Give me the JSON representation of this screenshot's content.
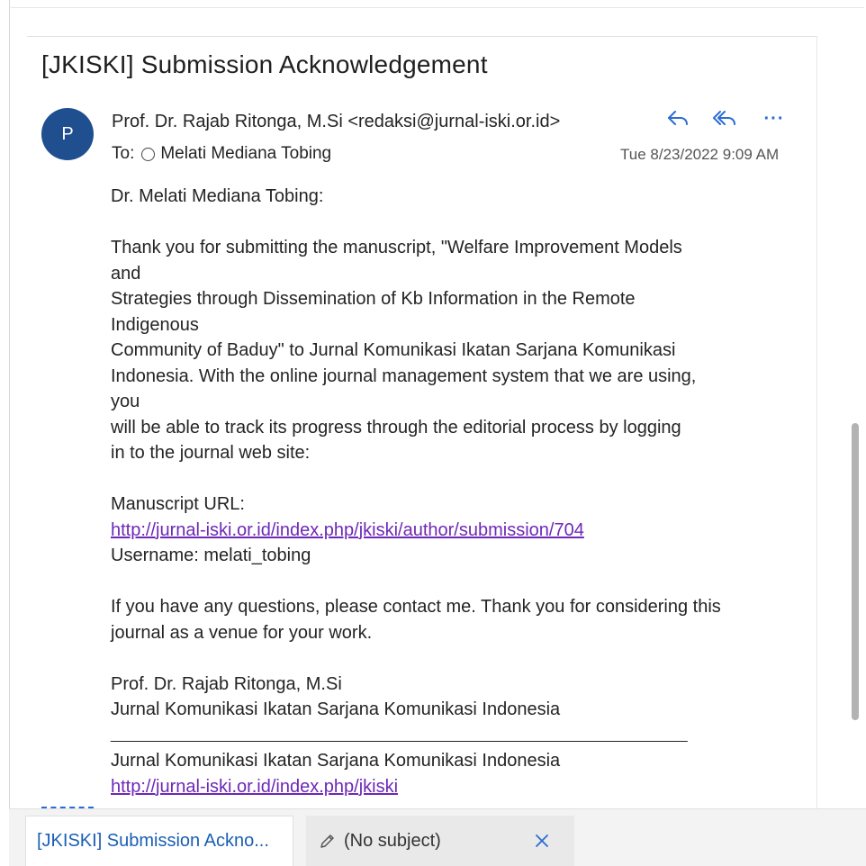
{
  "email": {
    "subject": "[JKISKI] Submission Acknowledgement",
    "avatar_initial": "P",
    "from": "Prof. Dr. Rajab Ritonga, M.Si <redaksi@jurnal-iski.or.id>",
    "to_label": "To:",
    "to_name": "Melati Mediana Tobing",
    "date": "Tue 8/23/2022 9:09 AM",
    "actions": {
      "reply": "reply-icon",
      "reply_all": "reply-all-icon",
      "more": "···"
    },
    "body": {
      "greeting": "Dr. Melati Mediana Tobing:",
      "p1": [
        "Thank you for submitting the manuscript, \"Welfare Improvement Models",
        "and",
        "Strategies through Dissemination of Kb Information  in the Remote",
        "Indigenous",
        "Community of Baduy\" to Jurnal Komunikasi Ikatan Sarjana Komunikasi",
        "Indonesia. With the online journal management system that we are using,",
        "you",
        "will be able to track its progress through the editorial process by logging",
        "in to the journal web site:"
      ],
      "manuscript_url_label": "Manuscript URL:",
      "manuscript_url": "http://jurnal-iski.or.id/index.php/jkiski/author/submission/704",
      "username": "Username: melati_tobing",
      "p2": [
        "If you have any questions, please contact me. Thank you for considering this",
        "journal as a venue for your work."
      ],
      "signature_name": "Prof. Dr. Rajab Ritonga, M.Si",
      "signature_journal": "Jurnal Komunikasi Ikatan Sarjana Komunikasi Indonesia",
      "separator": "________________________________________________________________________",
      "footer_journal": "Jurnal Komunikasi Ikatan Sarjana Komunikasi Indonesia",
      "footer_url": "http://jurnal-iski.or.id/index.php/jkiski"
    }
  },
  "tabs": [
    {
      "label": "[JKISKI] Submission Ackno...",
      "active": true
    },
    {
      "label": "(No subject)",
      "icon": "pencil-icon",
      "close_icon": "close-icon"
    }
  ],
  "colors": {
    "accent": "#2b6cd4",
    "avatar": "#1f4f8f",
    "link": "#6d28b7",
    "active_tab_text": "#1a5fb4"
  }
}
